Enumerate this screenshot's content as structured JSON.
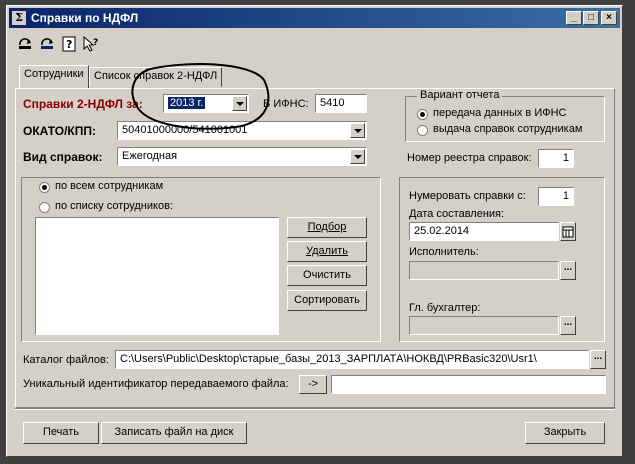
{
  "window": {
    "title": "Справки по НДФЛ",
    "icon_glyph": "Σ"
  },
  "window_controls": {
    "minimize": "_",
    "maximize": "□",
    "close": "×"
  },
  "toolbar": [
    "refresh-icon",
    "refresh-alt-icon",
    "help-icon",
    "whats-this-icon"
  ],
  "tabs": [
    "Сотрудники",
    "Список справок 2-НДФЛ"
  ],
  "report": {
    "label": "Справки 2-НДФЛ за:",
    "year": "2013 г.",
    "ifns_label": "В ИФНС:",
    "ifns_value": "5410",
    "okato_label": "ОКАТО/КПП:",
    "okato_value": "50401000000/541001001",
    "kind_label": "Вид справок:",
    "kind_value": "Ежегодная"
  },
  "variant": {
    "title": "Вариант отчета",
    "options": [
      "передача данных в ИФНС",
      "выдача справок сотрудникам"
    ],
    "selected": 0
  },
  "registry": {
    "label": "Номер реестра справок:",
    "value": "1"
  },
  "employees": {
    "options": [
      "по всем сотрудникам",
      "по списку сотрудников:"
    ],
    "selected": 0,
    "buttons": [
      "Подбор",
      "Удалить",
      "Очистить",
      "Сортировать"
    ]
  },
  "right": {
    "number_label": "Нумеровать справки с:",
    "number_value": "1",
    "date_label": "Дата составления:",
    "date_value": "25.02.2014",
    "executor_label": "Исполнитель:",
    "executor_value": "",
    "accountant_label": "Гл. бухгалтер:",
    "accountant_value": ""
  },
  "catalog": {
    "label": "Каталог файлов:",
    "value": "C:\\Users\\Public\\Desktop\\старые_базы_2013_ЗАРПЛАТА\\НОКВД\\PRBasic320\\Usr1\\",
    "browse": "..."
  },
  "file_id": {
    "label": "Уникальный идентификатор передаваемого файла:",
    "button": "->",
    "value": ""
  },
  "footer": {
    "print": "Печать",
    "write": "Записать файл на диск",
    "close": "Закрыть"
  }
}
